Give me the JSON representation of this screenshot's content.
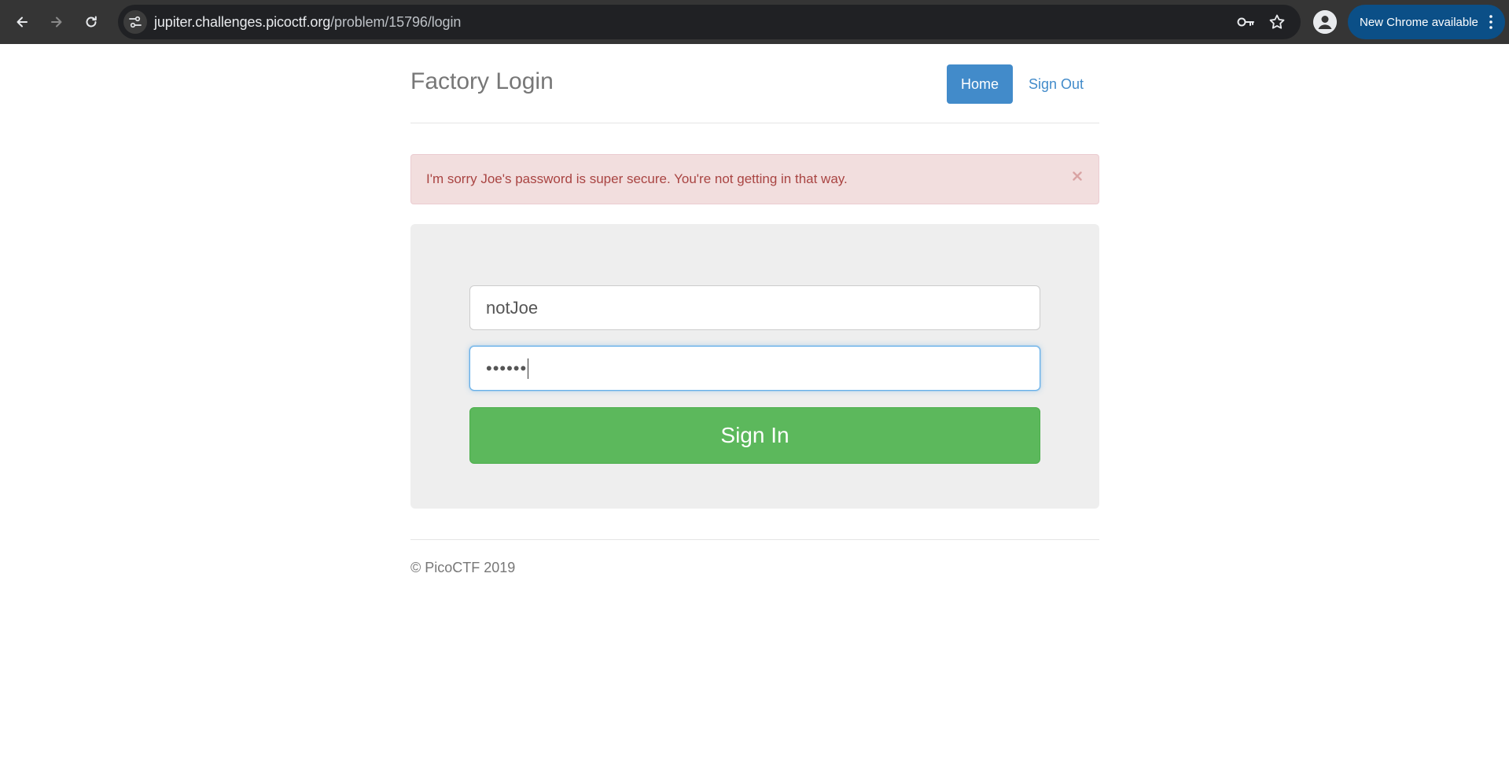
{
  "browser": {
    "url_host": "jupiter.challenges.picoctf.org",
    "url_path": "/problem/15796/login",
    "update_label": "New Chrome available",
    "icons": {
      "back": "back-arrow-icon",
      "forward": "forward-arrow-icon",
      "reload": "reload-icon",
      "site_info": "tune-icon",
      "password": "key-icon",
      "bookmark": "star-icon",
      "profile": "profile-icon",
      "menu": "more-vert-icon"
    }
  },
  "header": {
    "brand": "Factory Login",
    "nav": {
      "home": "Home",
      "sign_out": "Sign Out"
    }
  },
  "alert": {
    "message": "I'm sorry Joe's password is super secure. You're not getting in that way.",
    "close": "×"
  },
  "form": {
    "username_value": "notJoe",
    "password_value": "••••••",
    "submit_label": "Sign In"
  },
  "footer": {
    "copyright": "© PicoCTF 2019"
  },
  "colors": {
    "chrome_bg": "#353535",
    "omnibox_bg": "#202124",
    "update_pill": "#0b4f87",
    "primary": "#428bca",
    "success": "#5cb85c",
    "alert_bg": "#f2dede",
    "alert_text": "#a94442",
    "panel_bg": "#eeeeee"
  }
}
